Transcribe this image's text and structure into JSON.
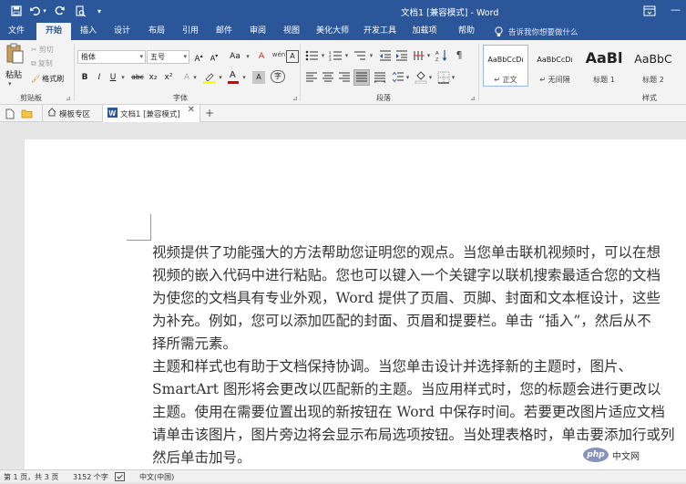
{
  "window": {
    "title": "文档1 [兼容模式] - Word",
    "colors": {
      "accent": "#2b579a",
      "ribbon": "#f3f3f3",
      "doc_bg": "#e6e6e6",
      "page": "#ffffff"
    }
  },
  "quick_access": {
    "icons": [
      "save-icon",
      "undo-icon",
      "redo-icon",
      "print-preview-icon",
      "customize-icon"
    ]
  },
  "window_controls": {
    "ribbon_display": "restore-ribbon-icon",
    "minimize": "—"
  },
  "menu_tabs": [
    "文件",
    "开始",
    "插入",
    "设计",
    "布局",
    "引用",
    "邮件",
    "审阅",
    "视图",
    "美化大师",
    "开发工具",
    "加载项",
    "帮助"
  ],
  "active_tab": "开始",
  "tell_me": {
    "placeholder": "告诉我你想要做什么"
  },
  "clipboard": {
    "paste_label": "粘贴",
    "cut_label": "剪切",
    "copy_label": "复制",
    "format_painter_label": "格式刷",
    "group_label": "剪贴板"
  },
  "font": {
    "family": "楷体",
    "size": "五号",
    "aa_label": "Aa",
    "wen_label": "wén",
    "group_label": "字体",
    "buttons": [
      "B",
      "I",
      "U",
      "abc",
      "x₂",
      "x²"
    ]
  },
  "paragraph": {
    "group_label": "段落"
  },
  "styles": {
    "group_label": "样式",
    "cards": [
      {
        "preview": "AaBbCcDı",
        "name": "↵ 正文",
        "selected": true
      },
      {
        "preview": "AaBbCcDı",
        "name": "↵ 无间隔",
        "selected": false
      },
      {
        "preview": "AaBl",
        "name": "标题 1",
        "selected": false
      },
      {
        "preview": "AaBbC",
        "name": "标题 2",
        "selected": false
      }
    ]
  },
  "doc_tabs": [
    {
      "label": "模板专区",
      "icon": "home-icon"
    },
    {
      "label": "文档1 [兼容模式]",
      "icon": "word-doc-icon"
    }
  ],
  "document": {
    "lines": [
      "视频提供了功能强大的方法帮助您证明您的观点。当您单击联机视频时，可以在想",
      "视频的嵌入代码中进行粘贴。您也可以键入一个关键字以联机搜索最适合您的文档",
      "为使您的文档具有专业外观，Word 提供了页眉、页脚、封面和文本框设计，这些",
      "为补充。例如，您可以添加匹配的封面、页眉和提要栏。单击 “插入”，然后从不",
      "择所需元素。",
      "主题和样式也有助于文档保持协调。当您单击设计并选择新的主题时，图片、",
      "SmartArt 图形将会更改以匹配新的主题。当应用样式时，您的标题会进行更改以",
      "主题。使用在需要位置出现的新按钮在 Word 中保存时间。若要更改图片适应文档",
      "请单击该图片，图片旁边将会显示布局选项按钮。当处理表格时，单击要添加行或列",
      "然后单击加号。"
    ]
  },
  "status": {
    "page": "第 1 页，共 3 页",
    "words": "3152 个字",
    "language": "中文(中国)"
  },
  "watermark": {
    "text": "php 中文网"
  }
}
